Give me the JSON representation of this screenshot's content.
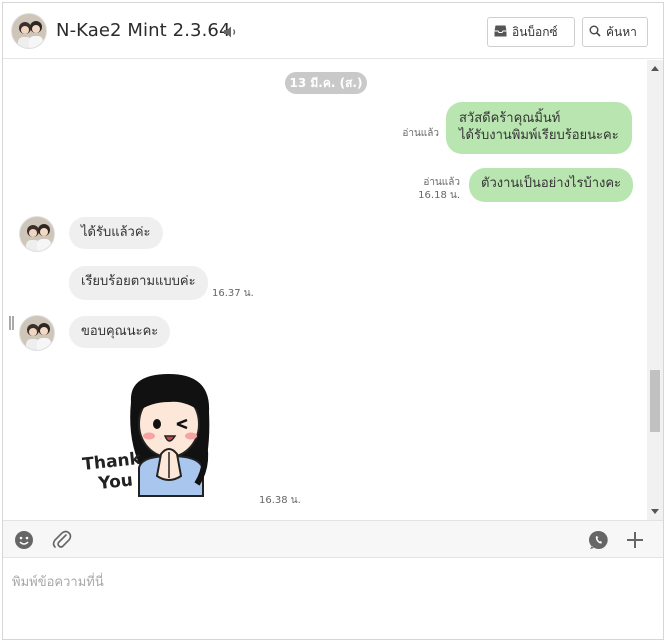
{
  "header": {
    "title": "N-Kae2 Mint 2.3.64",
    "inbox_label": "อินบ็อกซ์",
    "search_label": "ค้นหา"
  },
  "chat": {
    "date_divider": "13 มี.ค. (ส.)",
    "messages": [
      {
        "side": "out",
        "lines": [
          "สวัสดีคร้าคุณมิ้นท์",
          "ได้รับงานพิมพ์เรียบร้อยนะคะ"
        ],
        "status": "อ่านแล้ว",
        "time": ""
      },
      {
        "side": "out",
        "lines": [
          "ตัวงานเป็นอย่างไรบ้างคะ"
        ],
        "status": "อ่านแล้ว",
        "time": "16.18 น."
      },
      {
        "side": "in",
        "lines": [
          "ได้รับแล้วค่ะ"
        ],
        "time": ""
      },
      {
        "side": "in",
        "lines": [
          "เรียบร้อยตามแบบค่ะ"
        ],
        "time": "16.37 น."
      },
      {
        "side": "in",
        "lines": [
          "ขอบคุณนะคะ"
        ],
        "time": ""
      },
      {
        "side": "in",
        "type": "sticker",
        "sticker_text": [
          "Thank",
          "You"
        ],
        "time": "16.38 น."
      }
    ]
  },
  "composer": {
    "placeholder": "พิมพ์ข้อความที่นี่"
  },
  "colors": {
    "outgoing_bubble": "#b9e6b0",
    "incoming_bubble": "#efefef",
    "date_pill": "#c9c9c9"
  },
  "icons": {
    "sound": "speaker-icon",
    "inbox": "inbox-icon",
    "search": "search-icon",
    "emoji": "emoji-icon",
    "attach": "paperclip-icon",
    "voice": "voice-call-icon",
    "more": "plus-icon"
  }
}
